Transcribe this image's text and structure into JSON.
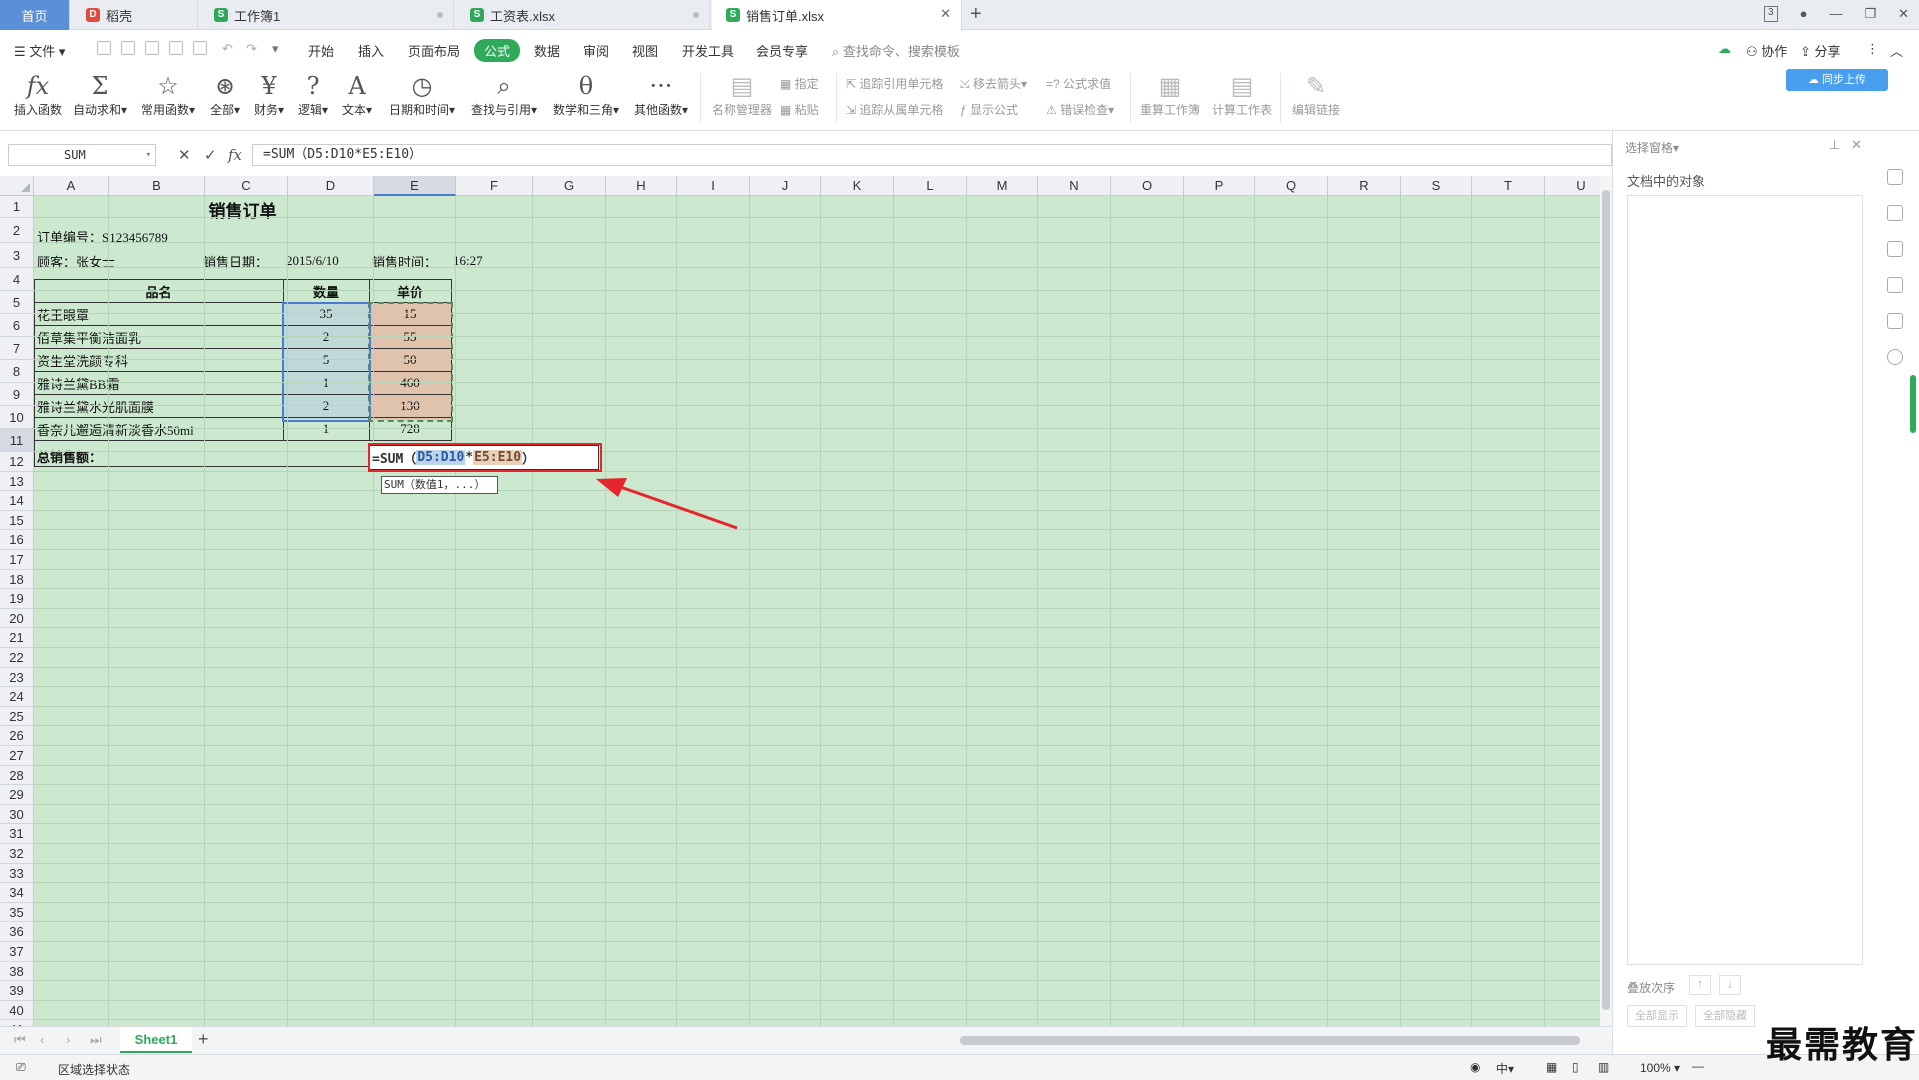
{
  "tabs": [
    {
      "label": "首页"
    },
    {
      "label": "稻壳"
    },
    {
      "label": "工作簿1"
    },
    {
      "label": "工资表.xlsx"
    },
    {
      "label": "销售订单.xlsx"
    }
  ],
  "window": {
    "badge": "3"
  },
  "menubar": {
    "file": "文件",
    "items": [
      "开始",
      "插入",
      "页面布局",
      "公式",
      "数据",
      "审阅",
      "视图",
      "开发工具",
      "会员专享"
    ],
    "search": "查找命令、搜索模板",
    "collab": "协作",
    "share": "分享"
  },
  "ribbon": {
    "big": [
      {
        "label": "插入函数",
        "glyph": "fx"
      },
      {
        "label": "自动求和▾",
        "glyph": "Σ"
      },
      {
        "label": "常用函数▾",
        "glyph": "☆"
      },
      {
        "label": "全部▾",
        "glyph": "⊛"
      },
      {
        "label": "财务▾",
        "glyph": "¥"
      },
      {
        "label": "逻辑▾",
        "glyph": "?"
      },
      {
        "label": "文本▾",
        "glyph": "A"
      },
      {
        "label": "日期和时间▾",
        "glyph": "◷"
      },
      {
        "label": "查找与引用▾",
        "glyph": "⌕"
      },
      {
        "label": "数学和三角▾",
        "glyph": "θ"
      },
      {
        "label": "其他函数▾",
        "glyph": "···"
      }
    ],
    "name_mgr": "名称管理器",
    "specify": "指定",
    "paste": "粘贴",
    "trace_prec": "追踪引用单元格",
    "trace_dep": "追踪从属单元格",
    "remove_arrows": "移去箭头▾",
    "show_formula": "显示公式",
    "eval_formula": "公式求值",
    "error_check": "错误检查▾",
    "recalc_wb": "重算工作簿",
    "calc_sheet": "计算工作表",
    "edit_links": "编辑链接",
    "cloud_btn": "同步上传"
  },
  "formula_bar": {
    "name_box": "SUM",
    "fx": "fx",
    "formula": "=SUM（D5:D10*E5:E10）"
  },
  "columns": [
    "A",
    "B",
    "C",
    "D",
    "E",
    "F",
    "G",
    "H",
    "I",
    "J",
    "K",
    "L",
    "M",
    "N",
    "O",
    "P",
    "Q",
    "R",
    "S",
    "T",
    "U"
  ],
  "sheet": {
    "title": "销售订单",
    "order_no": "订单编号：S123456789",
    "customer": "顾客：张女士",
    "date_label": "销售日期：",
    "date_value": "2015/6/10",
    "time_label": "销售时间：",
    "time_value": "16:27",
    "headers": {
      "name": "品名",
      "qty": "数量",
      "price": "单价"
    },
    "rows": [
      {
        "name": "花王眼罩",
        "qty": "35",
        "price": "15"
      },
      {
        "name": "佰草集平衡洁面乳",
        "qty": "2",
        "price": "55"
      },
      {
        "name": "资生堂洗颜专科",
        "qty": "5",
        "price": "50"
      },
      {
        "name": "雅诗兰黛BB霜",
        "qty": "1",
        "price": "460"
      },
      {
        "name": "雅诗兰黛水光肌面膜",
        "qty": "2",
        "price": "130"
      },
      {
        "name": "香奈儿邂逅清新淡香水50ml",
        "qty": "1",
        "price": "728"
      }
    ],
    "total_label": "总销售额：",
    "edit": {
      "prefix": "=SUM（",
      "range1": "D5:D10",
      "op": "*",
      "range2": "E5:E10",
      "suffix": "）"
    },
    "tooltip": "SUM（数值1，...）"
  },
  "right_pane": {
    "title": "选择窗格▾",
    "subtitle": "文档中的对象",
    "order": "叠放次序",
    "show_all": "全部显示",
    "hide_all": "全部隐藏"
  },
  "sheet_tab": "Sheet1",
  "status": {
    "mode": "区域选择状态",
    "zoom": "100%"
  },
  "watermark": "最需教育",
  "colors": {
    "accent": "#2eaa5a",
    "grid_bg": "#cce8cf",
    "red": "#e6262c"
  }
}
